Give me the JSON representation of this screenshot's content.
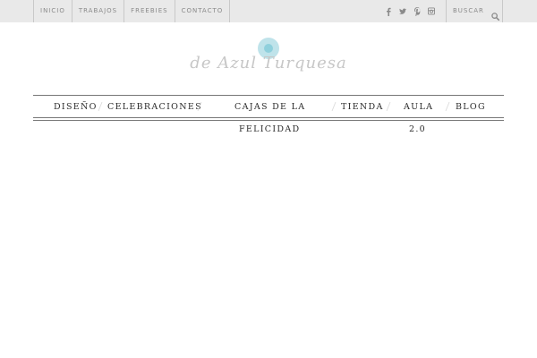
{
  "topbar": {
    "links": [
      "INICIO",
      "TRABAJOS",
      "FREEBIES",
      "CONTACTO"
    ],
    "social_icons": [
      "facebook-icon",
      "twitter-icon",
      "pinterest-icon",
      "instagram-icon"
    ],
    "search_label": "BUSCAR",
    "search_icon": "search-icon"
  },
  "logo": {
    "text": "de Azul Turquesa",
    "accent_color": "#8fd0dc"
  },
  "mainnav": {
    "items": [
      {
        "label": "DISEÑO"
      },
      {
        "label": "CELEBRACIONES"
      },
      {
        "label_line1": "CAJAS DE LA",
        "label_line2": "FELICIDAD"
      },
      {
        "label": "TIENDA"
      },
      {
        "label_line1": "AULA",
        "label_line2": "2.0"
      },
      {
        "label": "BLOG"
      }
    ]
  },
  "colors": {
    "topbar_bg": "#e9e9e9",
    "topbar_text": "#8a8a8a",
    "nav_text": "#2c2c2c"
  }
}
